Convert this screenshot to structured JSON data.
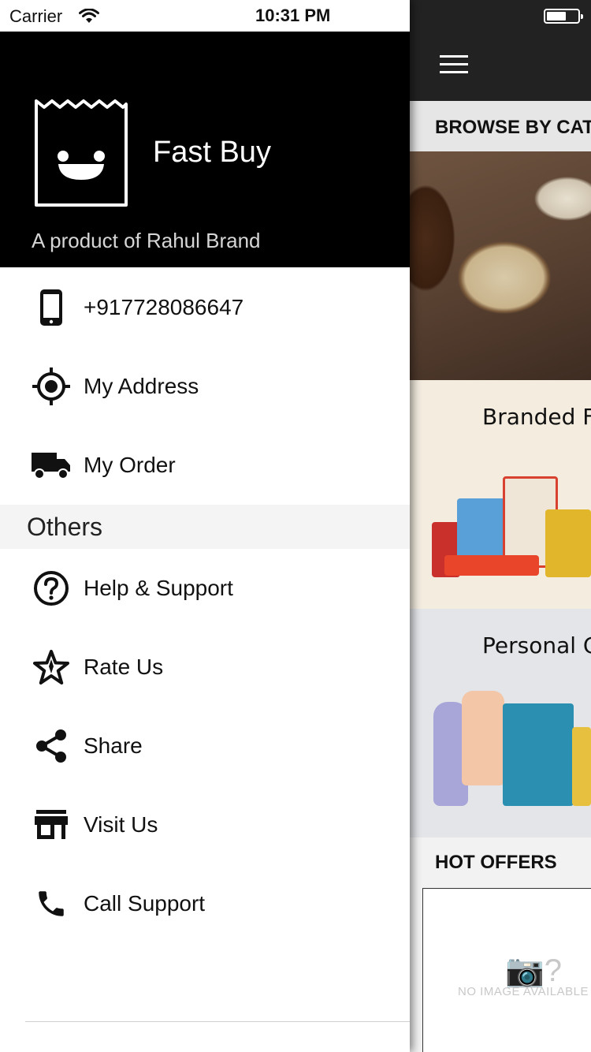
{
  "status_bar": {
    "carrier": "Carrier",
    "time": "10:31 PM"
  },
  "drawer": {
    "brand_name": "Fast Buy",
    "tagline": "A product of Rahul Brand",
    "account_items": [
      {
        "label": "+917728086647",
        "icon": "phone-icon"
      },
      {
        "label": "My Address",
        "icon": "location-icon"
      },
      {
        "label": "My Order",
        "icon": "truck-icon"
      }
    ],
    "others_header": "Others",
    "other_items": [
      {
        "label": "Help & Support",
        "icon": "help-icon"
      },
      {
        "label": "Rate Us",
        "icon": "star-icon"
      },
      {
        "label": "Share",
        "icon": "share-icon"
      },
      {
        "label": "Visit Us",
        "icon": "store-icon"
      },
      {
        "label": "Call Support",
        "icon": "call-icon"
      }
    ]
  },
  "main": {
    "browse_header": "BROWSE BY CATEGORY",
    "categories": [
      {
        "title": ""
      },
      {
        "title": "Branded Food"
      },
      {
        "title": "Personal Care"
      }
    ],
    "hot_offers_header": "HOT OFFERS",
    "no_image_text": "NO IMAGE AVAILABLE"
  }
}
